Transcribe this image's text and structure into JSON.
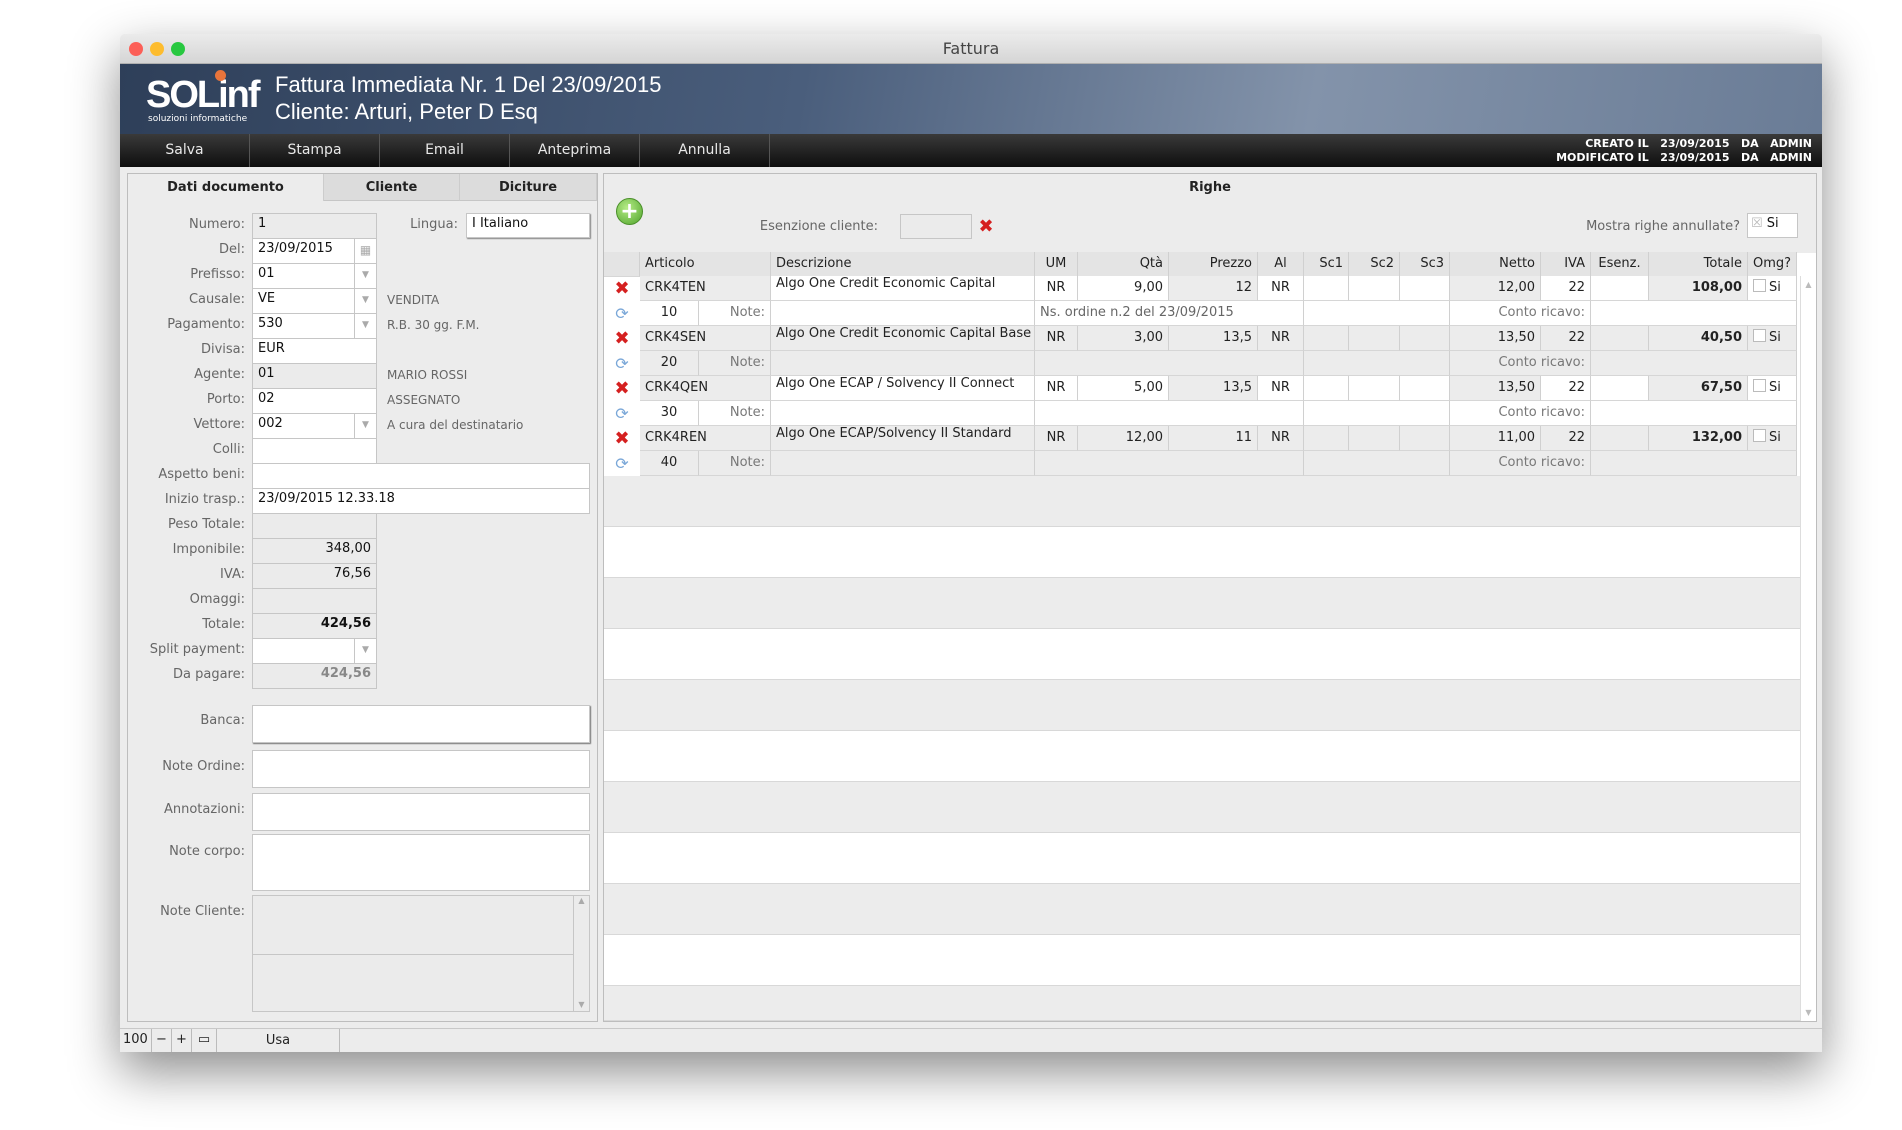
{
  "window": {
    "title": "Fattura"
  },
  "header": {
    "logo": "SOLinf",
    "logo_sub": "soluzioni informatiche",
    "title": "Fattura Immediata Nr. 1 Del 23/09/2015",
    "client": "Cliente: Arturi, Peter D Esq",
    "created": "CREATO IL   23/09/2015   DA   ADMIN",
    "modified": "MODIFICATO IL   23/09/2015   DA   ADMIN"
  },
  "toolbar": [
    "Salva",
    "Stampa",
    "Email",
    "Anteprima",
    "Annulla"
  ],
  "tabs": [
    "Dati documento",
    "Cliente",
    "Diciture"
  ],
  "form": {
    "fields": [
      {
        "label": "Numero:",
        "value": "1",
        "style": "g"
      },
      {
        "label": "Del:",
        "value": "23/09/2015",
        "style": "w",
        "icon": "calendar"
      },
      {
        "label": "Prefisso:",
        "value": "01",
        "style": "w",
        "dropdown": true
      },
      {
        "label": "Causale:",
        "value": "VE",
        "style": "w",
        "dropdown": true,
        "desc": "VENDITA"
      },
      {
        "label": "Pagamento:",
        "value": "530",
        "style": "w",
        "dropdown": true,
        "desc": "R.B. 30 gg. F.M."
      },
      {
        "label": "Divisa:",
        "value": "EUR",
        "style": "w"
      },
      {
        "label": "Agente:",
        "value": "01",
        "style": "g",
        "desc": "MARIO ROSSI"
      },
      {
        "label": "Porto:",
        "value": "02",
        "style": "w",
        "desc": "ASSEGNATO"
      },
      {
        "label": "Vettore:",
        "value": "002",
        "style": "w",
        "dropdown": true,
        "desc": "A cura del destinatario"
      },
      {
        "label": "Colli:",
        "value": "",
        "style": "w"
      },
      {
        "label": "Aspetto beni:",
        "value": "",
        "style": "w",
        "wide": true
      },
      {
        "label": "Inizio trasp.:",
        "value": "23/09/2015 12.33.18",
        "style": "w",
        "wide": true
      },
      {
        "label": "Peso Totale:",
        "value": "",
        "style": "g"
      },
      {
        "label": "Imponibile:",
        "value": "348,00",
        "style": "g",
        "right": true
      },
      {
        "label": "IVA:",
        "value": "76,56",
        "style": "g",
        "right": true
      },
      {
        "label": "Omaggi:",
        "value": "",
        "style": "g"
      },
      {
        "label": "Totale:",
        "value": "424,56",
        "style": "g",
        "right": true,
        "bold": true
      },
      {
        "label": "Split payment:",
        "value": "",
        "style": "w",
        "dropdown": true
      },
      {
        "label": "Da pagare:",
        "value": "424,56",
        "style": "g",
        "right": true,
        "bold": true,
        "muted": true
      }
    ],
    "lingua_label": "Lingua:",
    "lingua_value": "I Italiano",
    "banca_label": "Banca:",
    "note_ordine_label": "Note Ordine:",
    "annotazioni_label": "Annotazioni:",
    "note_corpo_label": "Note corpo:",
    "note_cliente_label": "Note Cliente:"
  },
  "righe": {
    "title": "Righe",
    "esenzione_label": "Esenzione cliente:",
    "mostra_label": "Mostra righe annullate?",
    "mostra_value": "Si",
    "columns": [
      "Articolo",
      "Descrizione",
      "UM",
      "Qtà",
      "Prezzo",
      "Al",
      "Sc1",
      "Sc2",
      "Sc3",
      "Netto",
      "IVA",
      "Esenz.",
      "Totale",
      "Omg?"
    ],
    "note_label": "Note:",
    "conto_label": "Conto ricavo:",
    "omg_label": "Si",
    "rows": [
      {
        "articolo": "CRK4TEN",
        "descrizione": "Algo One Credit Economic Capital",
        "um": "NR",
        "qta": "9,00",
        "prezzo": "12",
        "al": "NR",
        "netto": "12,00",
        "iva": "22",
        "totale": "108,00",
        "num": "10",
        "note": "Ns. ordine n.2 del 23/09/2015"
      },
      {
        "articolo": "CRK4SEN",
        "descrizione": "Algo One Credit Economic Capital Base",
        "um": "NR",
        "qta": "3,00",
        "prezzo": "13,5",
        "al": "NR",
        "netto": "13,50",
        "iva": "22",
        "totale": "40,50",
        "num": "20",
        "note": ""
      },
      {
        "articolo": "CRK4QEN",
        "descrizione": "Algo One ECAP / Solvency II Connect",
        "um": "NR",
        "qta": "5,00",
        "prezzo": "13,5",
        "al": "NR",
        "netto": "13,50",
        "iva": "22",
        "totale": "67,50",
        "num": "30",
        "note": ""
      },
      {
        "articolo": "CRK4REN",
        "descrizione": "Algo One ECAP/Solvency II Standard",
        "um": "NR",
        "qta": "12,00",
        "prezzo": "11",
        "al": "NR",
        "netto": "11,00",
        "iva": "22",
        "totale": "132,00",
        "num": "40",
        "note": ""
      }
    ]
  },
  "statusbar": {
    "zoom": "100",
    "mode": "Usa"
  }
}
